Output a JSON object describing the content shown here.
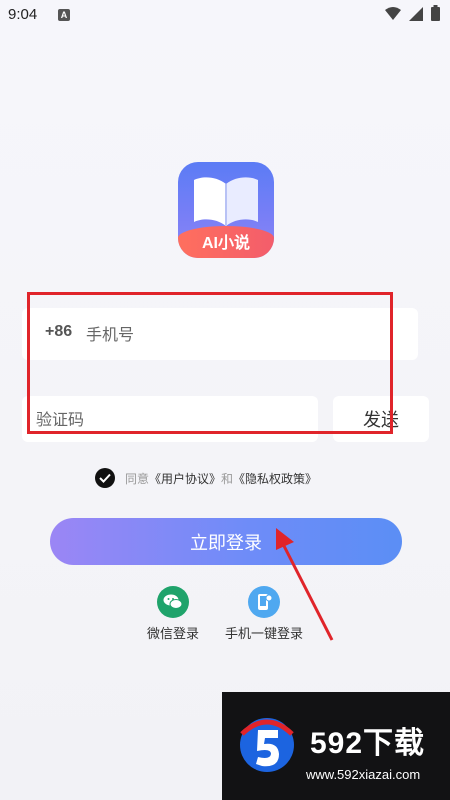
{
  "status_bar": {
    "time": "9:04",
    "notif_letter": "A"
  },
  "app": {
    "logo_text": "AI小说"
  },
  "form": {
    "phone_prefix": "+86",
    "phone_placeholder": "手机号",
    "code_placeholder": "验证码",
    "send_label": "发送"
  },
  "agreement": {
    "prefix": "同意",
    "user_agreement": "《用户协议》",
    "and": "和",
    "privacy_policy": "《隐私权政策》",
    "checked": true
  },
  "login_button_label": "立即登录",
  "alt_login": {
    "wechat_label": "微信登录",
    "onekey_label": "手机一键登录"
  },
  "watermark": {
    "brand": "592下载",
    "url": "www.592xiazai.com"
  },
  "colors": {
    "accent_start": "#9b86f5",
    "accent_end": "#5b8ef5",
    "wechat": "#1fa36b",
    "onekey": "#4fa8f0",
    "annotation_red": "#e0242a"
  }
}
